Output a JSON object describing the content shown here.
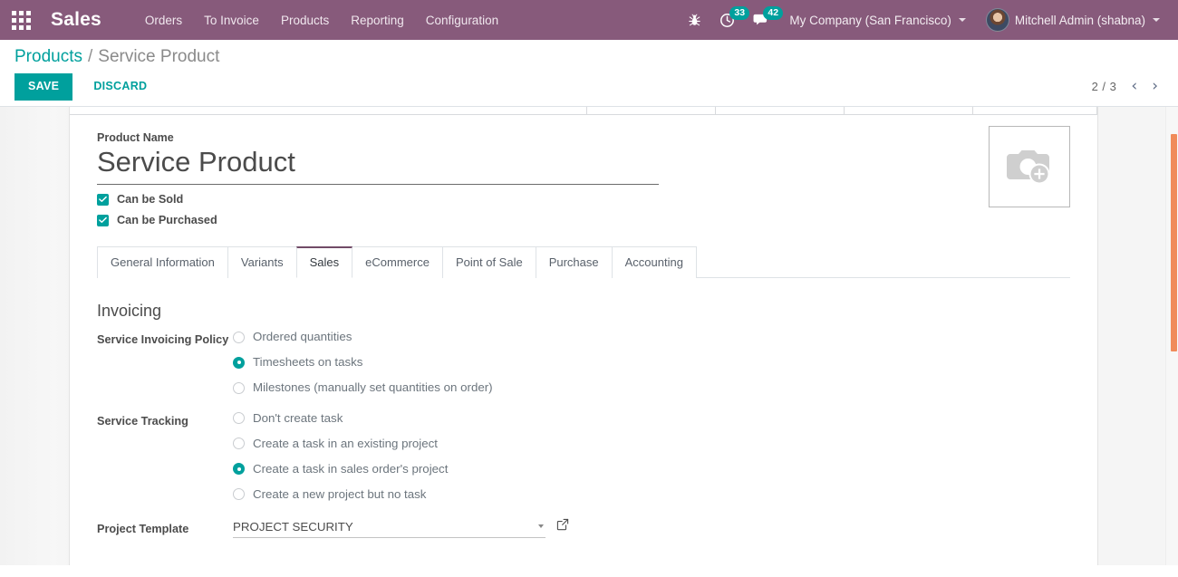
{
  "navbar": {
    "apps_icon": "apps-grid-icon",
    "brand": "Sales",
    "menus": [
      {
        "label": "Orders"
      },
      {
        "label": "To Invoice"
      },
      {
        "label": "Products"
      },
      {
        "label": "Reporting"
      },
      {
        "label": "Configuration"
      }
    ],
    "debug_icon": "bug-icon",
    "activity": {
      "icon": "clock-icon",
      "count": "33"
    },
    "messaging": {
      "icon": "chat-bubble-icon",
      "count": "42"
    },
    "company": "My Company (San Francisco)",
    "user": "Mitchell Admin (shabna)"
  },
  "control_panel": {
    "breadcrumb_root": "Products",
    "breadcrumb_sep": "/",
    "breadcrumb_current": "Service Product",
    "save_label": "SAVE",
    "discard_label": "DISCARD",
    "pager_value": "2 / 3",
    "pager_prev": "‹",
    "pager_next": "›"
  },
  "form": {
    "product_name_label": "Product Name",
    "product_name_value": "Service Product",
    "checkboxes": [
      {
        "label": "Can be Sold",
        "checked": true
      },
      {
        "label": "Can be Purchased",
        "checked": true
      }
    ],
    "image_placeholder_icon": "camera-add-icon"
  },
  "notebook": {
    "tabs": [
      {
        "label": "General Information",
        "active": false
      },
      {
        "label": "Variants",
        "active": false
      },
      {
        "label": "Sales",
        "active": true
      },
      {
        "label": "eCommerce",
        "active": false
      },
      {
        "label": "Point of Sale",
        "active": false
      },
      {
        "label": "Purchase",
        "active": false
      },
      {
        "label": "Accounting",
        "active": false
      }
    ]
  },
  "sales_tab": {
    "group_title": "Invoicing",
    "invoicing_policy": {
      "label": "Service Invoicing Policy",
      "options": [
        {
          "label": "Ordered quantities",
          "selected": false
        },
        {
          "label": "Timesheets on tasks",
          "selected": true
        },
        {
          "label": "Milestones (manually set quantities on order)",
          "selected": false
        }
      ]
    },
    "service_tracking": {
      "label": "Service Tracking",
      "options": [
        {
          "label": "Don't create task",
          "selected": false
        },
        {
          "label": "Create a task in an existing project",
          "selected": false
        },
        {
          "label": "Create a task in sales order's project",
          "selected": true
        },
        {
          "label": "Create a new project but no task",
          "selected": false
        }
      ]
    },
    "project_template": {
      "label": "Project Template",
      "value": "PROJECT SECURITY",
      "dropdown_icon": "caret-down-icon",
      "external_icon": "external-link-icon"
    }
  },
  "colors": {
    "navbar": "#875A7B",
    "accent": "#00A09D",
    "active_tab_border": "#714B67",
    "scrollbar": "#F08B5A"
  }
}
